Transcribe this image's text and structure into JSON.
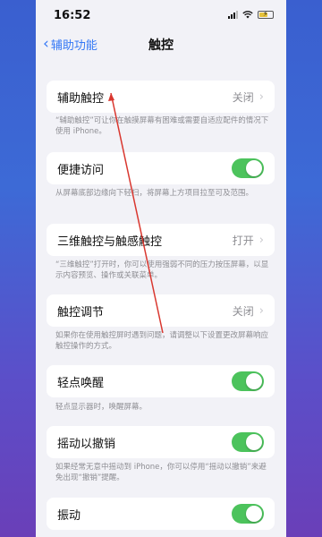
{
  "status": {
    "time": "16:52"
  },
  "nav": {
    "back_label": "辅助功能",
    "title": "触控"
  },
  "rows": [
    {
      "label": "辅助触控",
      "value": "关闭",
      "kind": "link",
      "desc": "“辅助触控”可让你在触摸屏幕有困难或需要自适应配件的情况下使用 iPhone。"
    },
    {
      "label": "便捷访问",
      "kind": "toggle",
      "on": true,
      "desc": "从屏幕底部边缘向下轻扫，将屏幕上方项目拉至可及范围。"
    },
    {
      "label": "三维触控与触感触控",
      "value": "打开",
      "kind": "link",
      "desc": "“三维触控”打开时，你可以使用强弱不同的压力按压屏幕，以显示内容预览、操作或关联菜单。"
    },
    {
      "label": "触控调节",
      "value": "关闭",
      "kind": "link",
      "desc": "如果你在使用触控屏时遇到问题，请调整以下设置更改屏幕响应触控操作的方式。"
    },
    {
      "label": "轻点唤醒",
      "kind": "toggle",
      "on": true,
      "desc": "轻点显示器时，唤醒屏幕。"
    },
    {
      "label": "摇动以撤销",
      "kind": "toggle",
      "on": true,
      "desc": "如果经常无意中摇动到 iPhone，你可以停用“摇动以撤销”来避免出现“撤销”提醒。"
    },
    {
      "label": "振动",
      "kind": "toggle",
      "on": true
    }
  ],
  "colors": {
    "accent": "#3478f6",
    "toggle_on": "#4cc35c",
    "annotation": "#d9372f"
  }
}
